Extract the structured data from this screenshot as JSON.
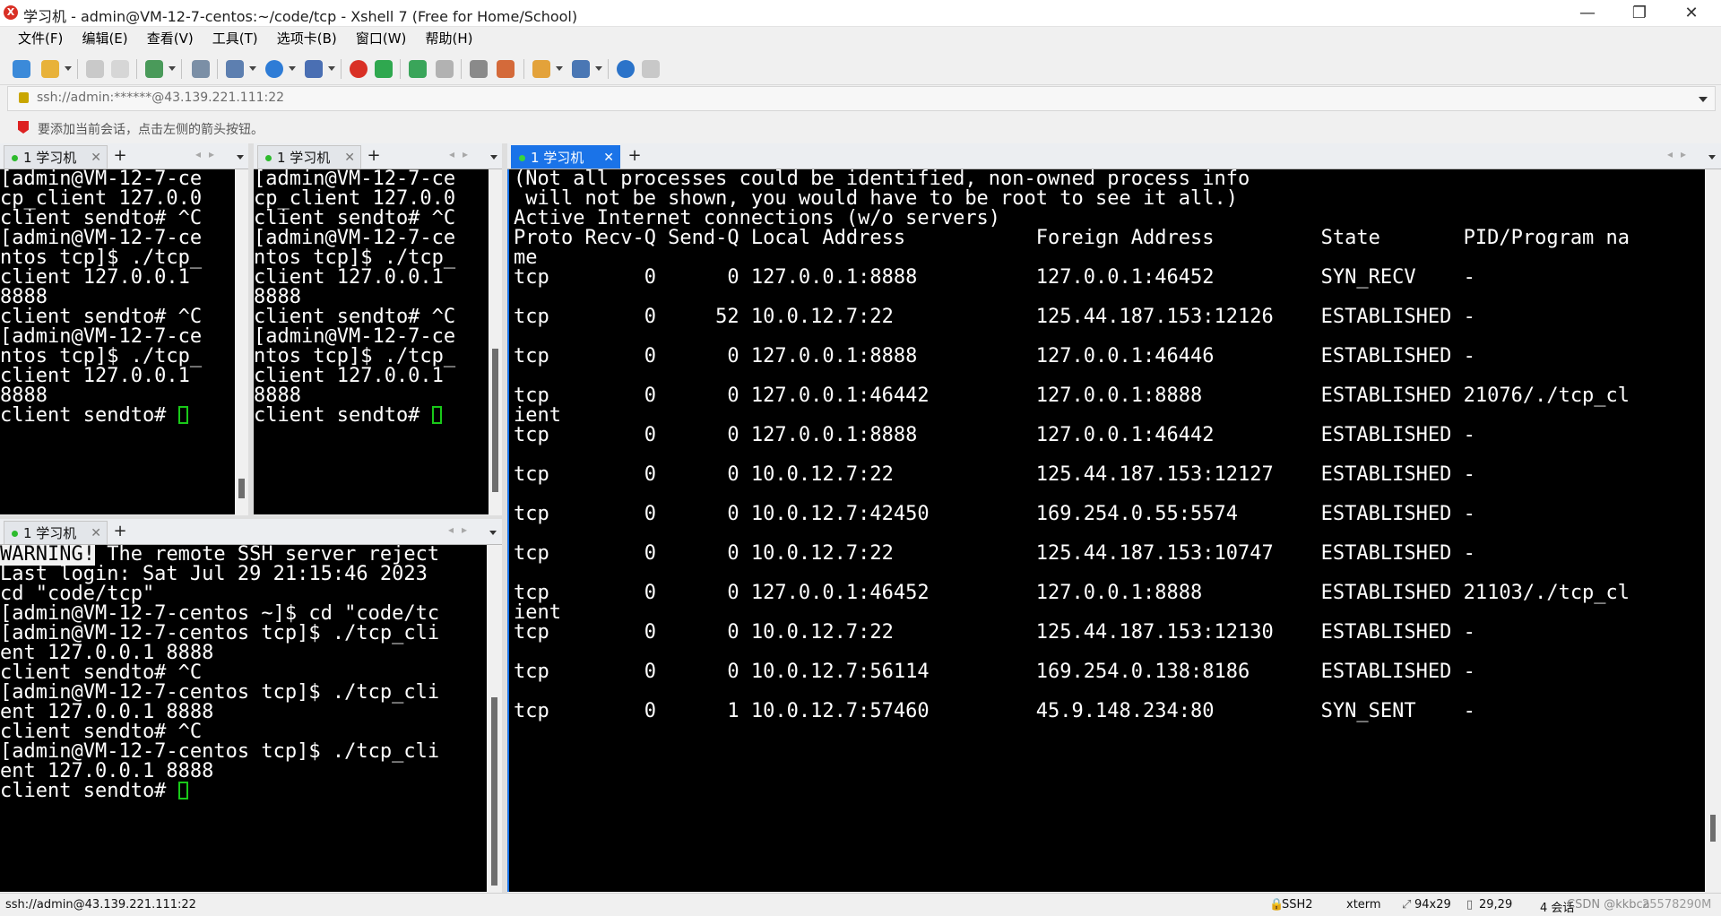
{
  "window": {
    "title": "学习机 - admin@VM-12-7-centos:~/code/tcp - Xshell 7 (Free for Home/School)"
  },
  "menu": [
    "文件(F)",
    "编辑(E)",
    "查看(V)",
    "工具(T)",
    "选项卡(B)",
    "窗口(W)",
    "帮助(H)"
  ],
  "address": {
    "value": "ssh://admin:******@43.139.221.111:22"
  },
  "hint": "要添加当前会话，点击左侧的箭头按钮。",
  "toolbar": [
    "new-session-icon",
    "open-folder-icon",
    "connect-icon",
    "disconnect-icon",
    "new-tab-icon",
    "find-icon",
    "properties-icon",
    "globe-icon",
    "font-icon",
    "xshell-icon",
    "xftp-icon",
    "fullscreen-icon",
    "lock-icon",
    "keyboard-icon",
    "script-icon",
    "compose-icon",
    "layout-icon",
    "help-icon",
    "chat-icon"
  ],
  "panes": {
    "top_left": {
      "tab_label": "1 学习机",
      "lines": [
        "[admin@VM-12-7-ce",
        "cp_client 127.0.0",
        "client sendto# ^C",
        "[admin@VM-12-7-ce",
        "ntos tcp]$ ./tcp_",
        "client 127.0.0.1",
        "8888",
        "client sendto# ^C",
        "[admin@VM-12-7-ce",
        "ntos tcp]$ ./tcp_",
        "client 127.0.0.1",
        "8888"
      ],
      "prompt": "client sendto# "
    },
    "top_middle": {
      "tab_label": "1 学习机",
      "lines": [
        "[admin@VM-12-7-ce",
        "cp_client 127.0.0",
        "client sendto# ^C",
        "[admin@VM-12-7-ce",
        "ntos tcp]$ ./tcp_",
        "client 127.0.0.1",
        "8888",
        "client sendto# ^C",
        "[admin@VM-12-7-ce",
        "ntos tcp]$ ./tcp_",
        "client 127.0.0.1",
        "8888"
      ],
      "prompt": "client sendto# "
    },
    "bottom_left": {
      "tab_label": "1 学习机",
      "warning_label": "WARNING!",
      "warning_rest": " The remote SSH server reject",
      "lines": [
        "Last login: Sat Jul 29 21:15:46 2023",
        "cd \"code/tcp\"",
        "[admin@VM-12-7-centos ~]$ cd \"code/tc",
        "[admin@VM-12-7-centos tcp]$ ./tcp_cli",
        "ent 127.0.0.1 8888",
        "client sendto# ^C",
        "[admin@VM-12-7-centos tcp]$ ./tcp_cli",
        "ent 127.0.0.1 8888",
        "client sendto# ^C",
        "[admin@VM-12-7-centos tcp]$ ./tcp_cli",
        "ent 127.0.0.1 8888"
      ],
      "prompt": "client sendto# "
    },
    "main": {
      "tab_label": "1 学习机",
      "lines": [
        "(Not all processes could be identified, non-owned process info",
        " will not be shown, you would have to be root to see it all.)",
        "Active Internet connections (w/o servers)",
        "Proto Recv-Q Send-Q Local Address           Foreign Address         State       PID/Program na",
        "me",
        "tcp        0      0 127.0.0.1:8888          127.0.0.1:46452         SYN_RECV    -",
        "",
        "tcp        0     52 10.0.12.7:22            125.44.187.153:12126    ESTABLISHED -",
        "",
        "tcp        0      0 127.0.0.1:8888          127.0.0.1:46446         ESTABLISHED -",
        "",
        "tcp        0      0 127.0.0.1:46442         127.0.0.1:8888          ESTABLISHED 21076/./tcp_cl",
        "ient",
        "tcp        0      0 127.0.0.1:8888          127.0.0.1:46442         ESTABLISHED -",
        "",
        "tcp        0      0 10.0.12.7:22            125.44.187.153:12127    ESTABLISHED -",
        "",
        "tcp        0      0 10.0.12.7:42450         169.254.0.55:5574       ESTABLISHED -",
        "",
        "tcp        0      0 10.0.12.7:22            125.44.187.153:10747    ESTABLISHED -",
        "",
        "tcp        0      0 127.0.0.1:46452         127.0.0.1:8888          ESTABLISHED 21103/./tcp_cl",
        "ient",
        "tcp        0      0 10.0.12.7:22            125.44.187.153:12130    ESTABLISHED -",
        "",
        "tcp        0      0 10.0.12.7:56114         169.254.0.138:8186      ESTABLISHED -",
        "",
        "tcp        0      1 10.0.12.7:57460         45.9.148.234:80         SYN_SENT    -"
      ]
    }
  },
  "status": {
    "connection": "ssh://admin@43.139.221.111:22",
    "protocol": "SSH2",
    "terminal": "xterm",
    "size": "94x29",
    "cursor": "29,29",
    "sessions": "4 会话",
    "watermark": "CSDN @kkbca",
    "overlay": "25578290M"
  },
  "colors": {
    "tab_active": "#1a73e8",
    "terminal_bg": "#000000",
    "cursor": "#19c919"
  }
}
